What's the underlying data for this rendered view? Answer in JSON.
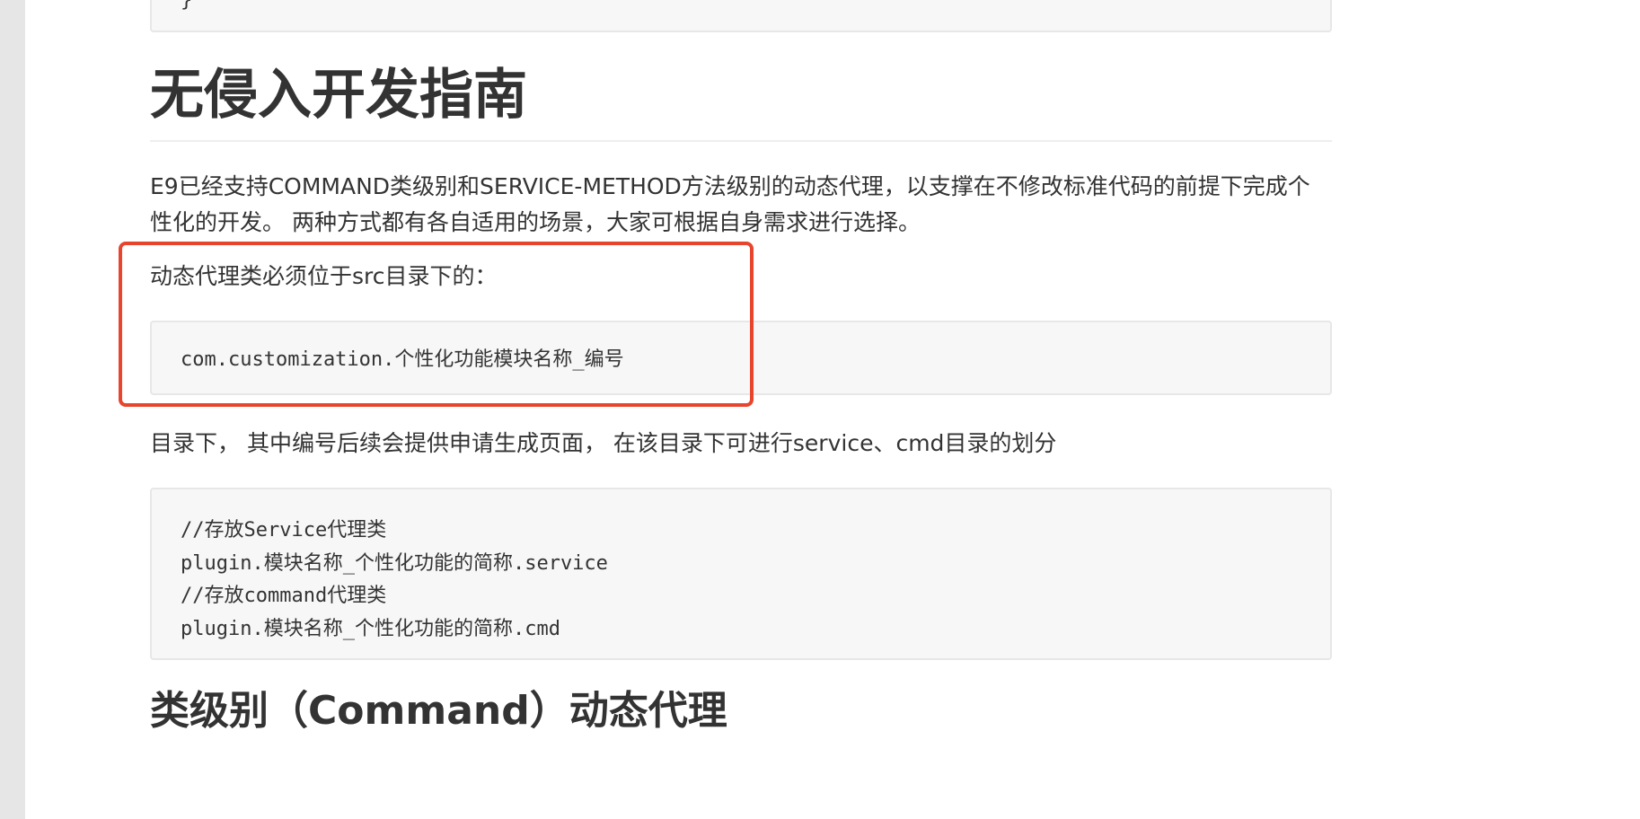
{
  "article": {
    "previous_code_tail": "}",
    "section_title": "无侵入开发指南",
    "intro_paragraph": "E9已经支持COMMAND类级别和SERVICE-METHOD方法级别的动态代理，以支撑在不修改标准代码的前提下完成个性化的开发。 两种方式都有各自适用的场景，大家可根据自身需求进行选择。",
    "requirement_text": "动态代理类必须位于src目录下的：",
    "package_code": "com.customization.个性化功能模块名称_编号",
    "after_text": "目录下， 其中编号后续会提供申请生成页面， 在该目录下可进行service、cmd目录的划分",
    "directory_code_lines": [
      "//存放Service代理类",
      "plugin.模块名称_个性化功能的简称.service",
      "//存放command代理类",
      "plugin.模块名称_个性化功能的简称.cmd"
    ],
    "next_section_title": "类级别（Command）动态代理"
  },
  "annotation": {
    "highlight_color": "#e8452e"
  }
}
